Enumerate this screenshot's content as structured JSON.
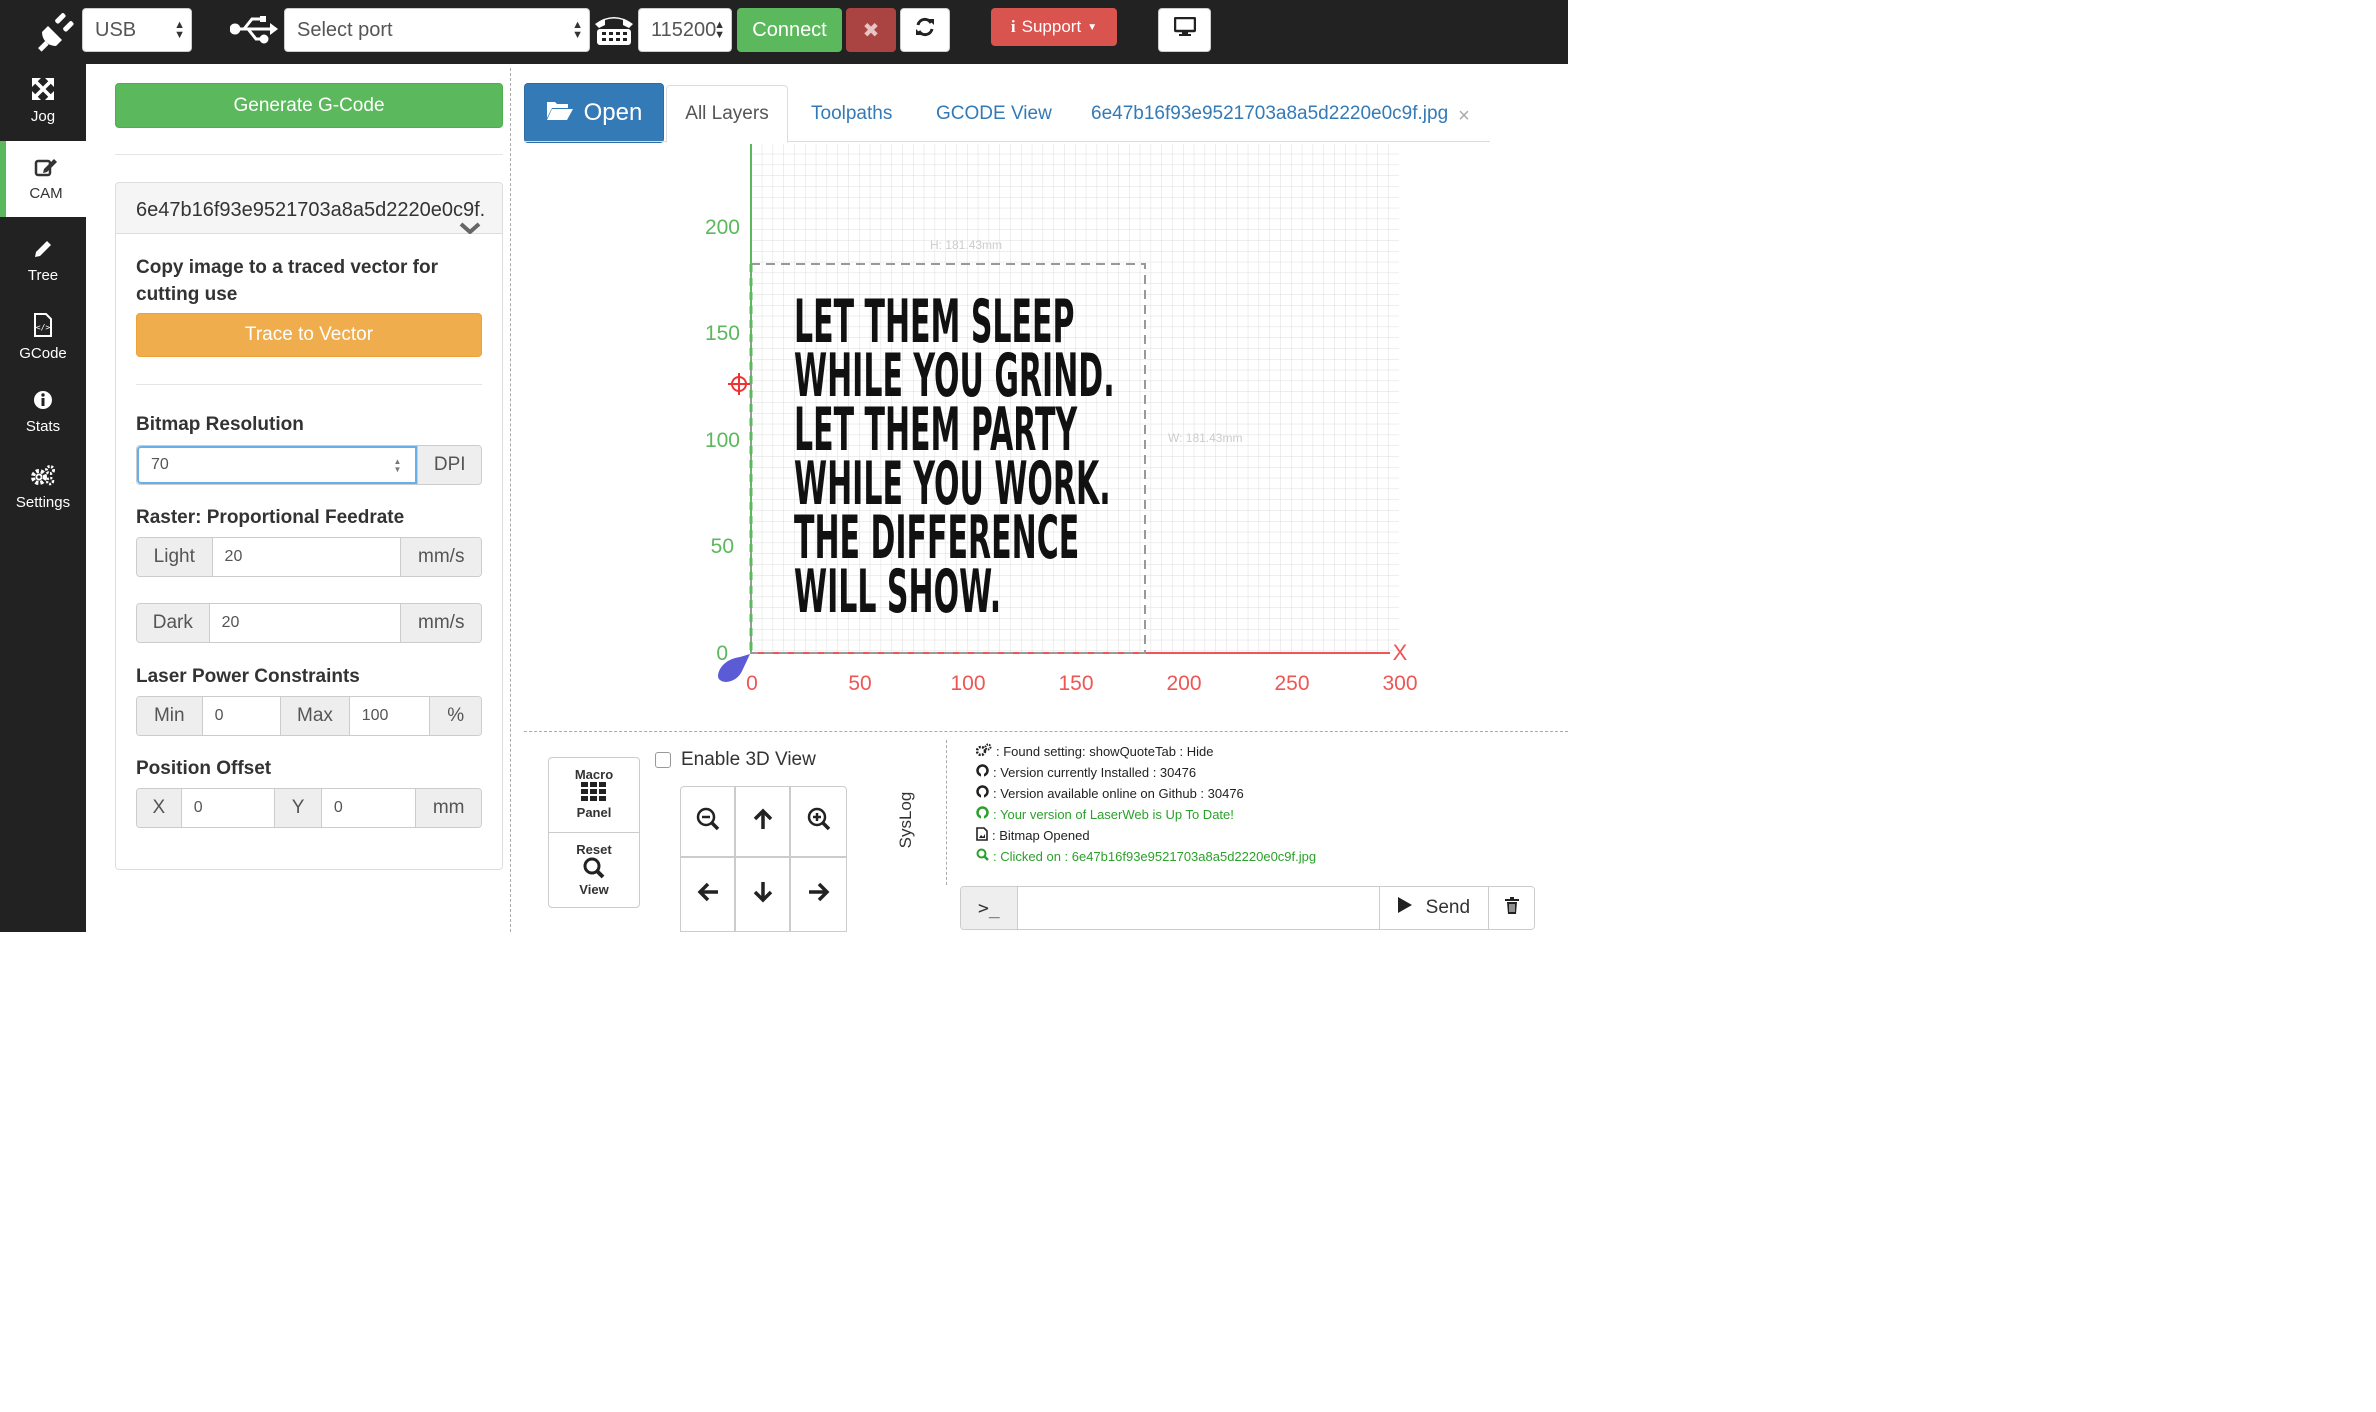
{
  "topbar": {
    "connection_type": "USB",
    "port_placeholder": "Select port",
    "baud_rate": "115200",
    "connect_label": "Connect",
    "support_label": "Support",
    "colors": {
      "connect": "#5cb85c",
      "disconnect": "#a94442",
      "support": "#d9534f"
    }
  },
  "sidebar": {
    "items": [
      {
        "label": "Jog",
        "icon": "move-icon"
      },
      {
        "label": "CAM",
        "icon": "edit-icon"
      },
      {
        "label": "Tree",
        "icon": "pencil-icon"
      },
      {
        "label": "GCode",
        "icon": "code-file-icon"
      },
      {
        "label": "Stats",
        "icon": "info-icon"
      },
      {
        "label": "Settings",
        "icon": "gears-icon"
      }
    ],
    "active": "CAM"
  },
  "cam": {
    "generate_label": "Generate G-Code",
    "file_name": "6e47b16f93e9521703a8a5d2220e0c9f.",
    "trace_desc": "Copy image to a traced vector for cutting use",
    "trace_label": "Trace to Vector",
    "bitmap_res_label": "Bitmap Resolution",
    "dpi_value": "70",
    "dpi_unit": "DPI",
    "raster_label": "Raster: Proportional Feedrate",
    "light_label": "Light",
    "light_value": "20",
    "dark_label": "Dark",
    "dark_value": "20",
    "feed_unit": "mm/s",
    "power_label": "Laser Power Constraints",
    "min_label": "Min",
    "min_value": "0",
    "max_label": "Max",
    "max_value": "100",
    "percent": "%",
    "offset_label": "Position Offset",
    "x_label": "X",
    "x_value": "0",
    "y_label": "Y",
    "y_value": "0",
    "offset_unit": "mm"
  },
  "tabs": {
    "open_label": "Open",
    "items": [
      "All Layers",
      "Toolpaths",
      "GCODE View",
      "6e47b16f93e9521703a8a5d2220e0c9f.jpg"
    ]
  },
  "canvas": {
    "y_ticks": [
      "200",
      "150",
      "100",
      "50",
      "0"
    ],
    "x_ticks": [
      "0",
      "50",
      "100",
      "150",
      "200",
      "250",
      "300"
    ],
    "x_axis_letter": "X",
    "height_label": "H: 181.43mm",
    "width_label": "W: 181.43mm",
    "quote_lines": [
      "LET THEM SLEEP",
      "WHILE YOU GRIND.",
      "LET THEM PARTY",
      "WHILE YOU WORK.",
      "THE DIFFERENCE",
      "WILL SHOW."
    ]
  },
  "bottom": {
    "macro_top": "Macro",
    "macro_bottom": "Panel",
    "reset_top": "Reset",
    "reset_bottom": "View",
    "enable_3d_label": "Enable 3D View",
    "syslog_label": "SysLog",
    "send_label": "Send",
    "console_prompt": ">_"
  },
  "log": [
    {
      "text": ": Found setting: showQuoteTab : Hide",
      "icon": "gears-icon",
      "color": "#222"
    },
    {
      "text": ": Version currently Installed : 30476",
      "icon": "github-icon",
      "color": "#222"
    },
    {
      "text": ": Version available online on Github : 30476",
      "icon": "github-icon",
      "color": "#222"
    },
    {
      "text": ": Your version of LaserWeb is Up To Date!",
      "icon": "github-icon",
      "color": "#2aa12a"
    },
    {
      "text": ": Bitmap Opened",
      "icon": "image-file-icon",
      "color": "#222"
    },
    {
      "text": ": Clicked on : 6e47b16f93e9521703a8a5d2220e0c9f.jpg",
      "icon": "search-icon",
      "color": "#2aa12a"
    }
  ]
}
